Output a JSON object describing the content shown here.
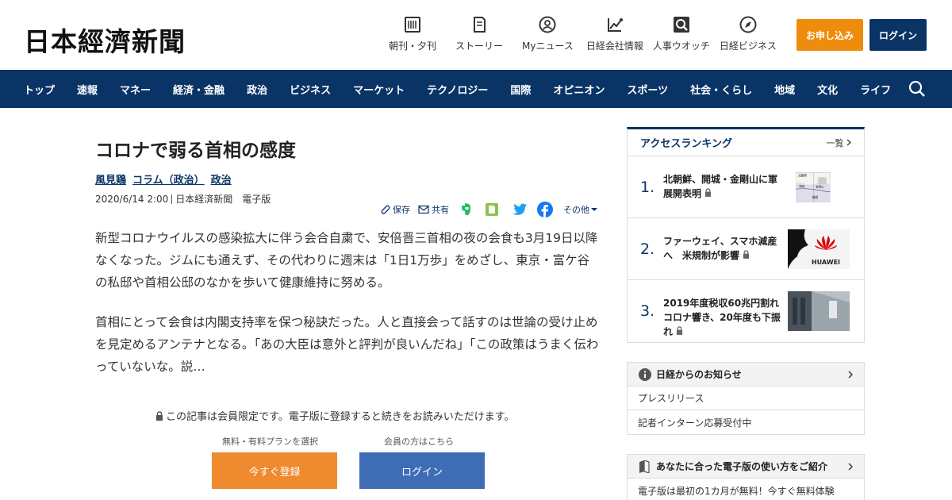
{
  "header": {
    "logo": "日本經濟新聞",
    "nav": [
      {
        "label": "朝刊・夕刊",
        "icon": "newspaper-icon"
      },
      {
        "label": "ストーリー",
        "icon": "bookmark-icon"
      },
      {
        "label": "Myニュース",
        "icon": "user-circle-icon"
      },
      {
        "label": "日経会社情報",
        "icon": "chart-icon"
      },
      {
        "label": "人事ウオッチ",
        "icon": "search-person-icon"
      },
      {
        "label": "日経ビジネス",
        "icon": "compass-icon"
      }
    ],
    "apply_label": "お申し込み",
    "login_label": "ログイン"
  },
  "navbar": {
    "items": [
      "トップ",
      "速報",
      "マネー",
      "経済・金融",
      "政治",
      "ビジネス",
      "マーケット",
      "テクノロジー",
      "国際",
      "オピニオン",
      "スポーツ",
      "社会・くらし",
      "地域",
      "文化",
      "ライフ"
    ]
  },
  "article": {
    "title": "コロナで弱る首相の感度",
    "tags": [
      "風見鶏",
      "コラム（政治）",
      "政治"
    ],
    "date": "2020/6/14 2:00",
    "source": "日本経済新聞　電子版",
    "share": {
      "save": "保存",
      "share": "共有",
      "more": "その他"
    },
    "paragraphs": [
      "新型コロナウイルスの感染拡大に伴う会合自粛で、安倍晋三首相の夜の会食も3月19日以降なくなった。ジムにも通えず、その代わりに週末は「1日1万歩」をめざし、東京・富ケ谷の私邸や首相公邸のなかを歩いて健康維持に努める。",
      "首相にとって会食は内閣支持率を保つ秘訣だった。人と直接会って話すのは世論の受け止めを見定めるアンテナとなる。「あの大臣は意外と評判が良いんだね」「この政策はうまく伝わっていないな。説…"
    ],
    "member_note": "この記事は会員限定です。電子版に登録すると続きをお読みいただけます。",
    "register_caption": "無料・有料プランを選択",
    "login_caption": "会員の方はこちら",
    "register_button": "今すぐ登録",
    "login_button": "ログイン"
  },
  "ranking": {
    "title": "アクセスランキング",
    "more": "一覧",
    "items": [
      {
        "num": "1.",
        "text": "北朝鮮、開城・金剛山に軍展開表明"
      },
      {
        "num": "2.",
        "text": "ファーウェイ、スマホ減産へ　米規制が影響"
      },
      {
        "num": "3.",
        "text": "2019年度税収60兆円割れ　コロナ響き、20年度も下振れ"
      }
    ],
    "thumb1_labels": [
      "北朝鮮",
      "開城",
      "金剛山",
      "韓国"
    ],
    "thumb2_label": "HUAWEI"
  },
  "notice": {
    "title": "日経からのお知らせ",
    "rows": [
      "プレスリリース",
      "記者インターン応募受付中"
    ]
  },
  "guide": {
    "title": "あなたに合った電子版の使い方をご紹介",
    "rows": [
      "電子版は最初の1カ月が無料！今すぐ無料体験"
    ]
  },
  "colors": {
    "navy": "#0a3466",
    "orange": "#f08c0c",
    "register": "#ef8a2f",
    "login_blue": "#3e6db5"
  }
}
